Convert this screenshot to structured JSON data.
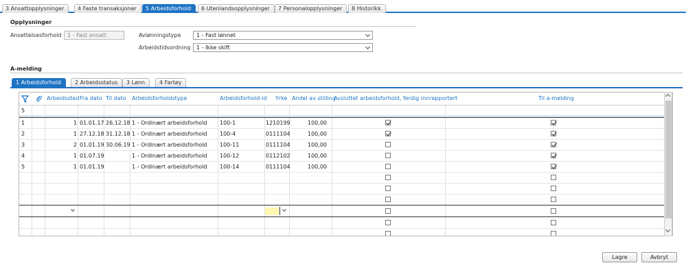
{
  "tabs": [
    "3 Ansattopplysninger",
    "4 Faste transaksjoner",
    "5 Arbeidsforhold",
    "6 Utenlandsopplysninger",
    "7 Personalopplysninger",
    "8 Historikk"
  ],
  "opplysninger": {
    "title": "Opplysninger",
    "ansettelse_label": "Ansettelsesforhold",
    "ansettelse_value": "1 - Fast ansatt",
    "avlonning_label": "Avlønningstype",
    "avlonning_value": "1 - Fast lønnet",
    "arbeidstid_label": "Arbeidstidsordning",
    "arbeidstid_value": "1 - Ikke skift"
  },
  "amelding": {
    "title": "A-melding"
  },
  "subtabs": [
    "1 Arbeidsforhold",
    "2 Arbeidsstatus",
    "3 Lønn",
    "4 Fartøy"
  ],
  "grid": {
    "headers": [
      "Arbeidssted",
      "Fra dato",
      "Til dato",
      "Arbeidsforholdstype",
      "Arbeidsforhold-id",
      "Yrke",
      "Andel av stilling",
      "Avsluttet arbeidsforhold, ferdig innrapportert",
      "Til a-melding"
    ],
    "count": "5",
    "rows": [
      {
        "n": "1",
        "sted": "1",
        "fra": "01.01.17",
        "til": "26.12.18",
        "type": "1 - Ordinært arbeidsforhold",
        "id": "100-1",
        "yrke": "1210199",
        "andel": "100,00",
        "avsl": true,
        "til_am": true
      },
      {
        "n": "2",
        "sted": "1",
        "fra": "27.12.18",
        "til": "31.12.18",
        "type": "1 - Ordinært arbeidsforhold",
        "id": "100-4",
        "yrke": "0111104",
        "andel": "100,00",
        "avsl": true,
        "til_am": true
      },
      {
        "n": "3",
        "sted": "2",
        "fra": "01.01.19",
        "til": "30.06.19",
        "type": "1 - Ordinært arbeidsforhold",
        "id": "100-11",
        "yrke": "0111104",
        "andel": "100,00",
        "avsl": false,
        "til_am": true
      },
      {
        "n": "4",
        "sted": "1",
        "fra": "01.07.19",
        "til": "",
        "type": "1 - Ordinært arbeidsforhold",
        "id": "100-12",
        "yrke": "0112102",
        "andel": "100,00",
        "avsl": false,
        "til_am": true
      },
      {
        "n": "5",
        "sted": "1",
        "fra": "01.01.19",
        "til": "",
        "type": "1 - Ordinært arbeidsforhold",
        "id": "100-14",
        "yrke": "0111104",
        "andel": "100,00",
        "avsl": false,
        "til_am": true
      }
    ]
  },
  "buttons": {
    "save": "Lagre",
    "cancel": "Avbryt"
  },
  "colors": {
    "accent": "#1e74c4",
    "selected_row": "#d8e8f7",
    "edit_cell": "#fff7b0"
  }
}
